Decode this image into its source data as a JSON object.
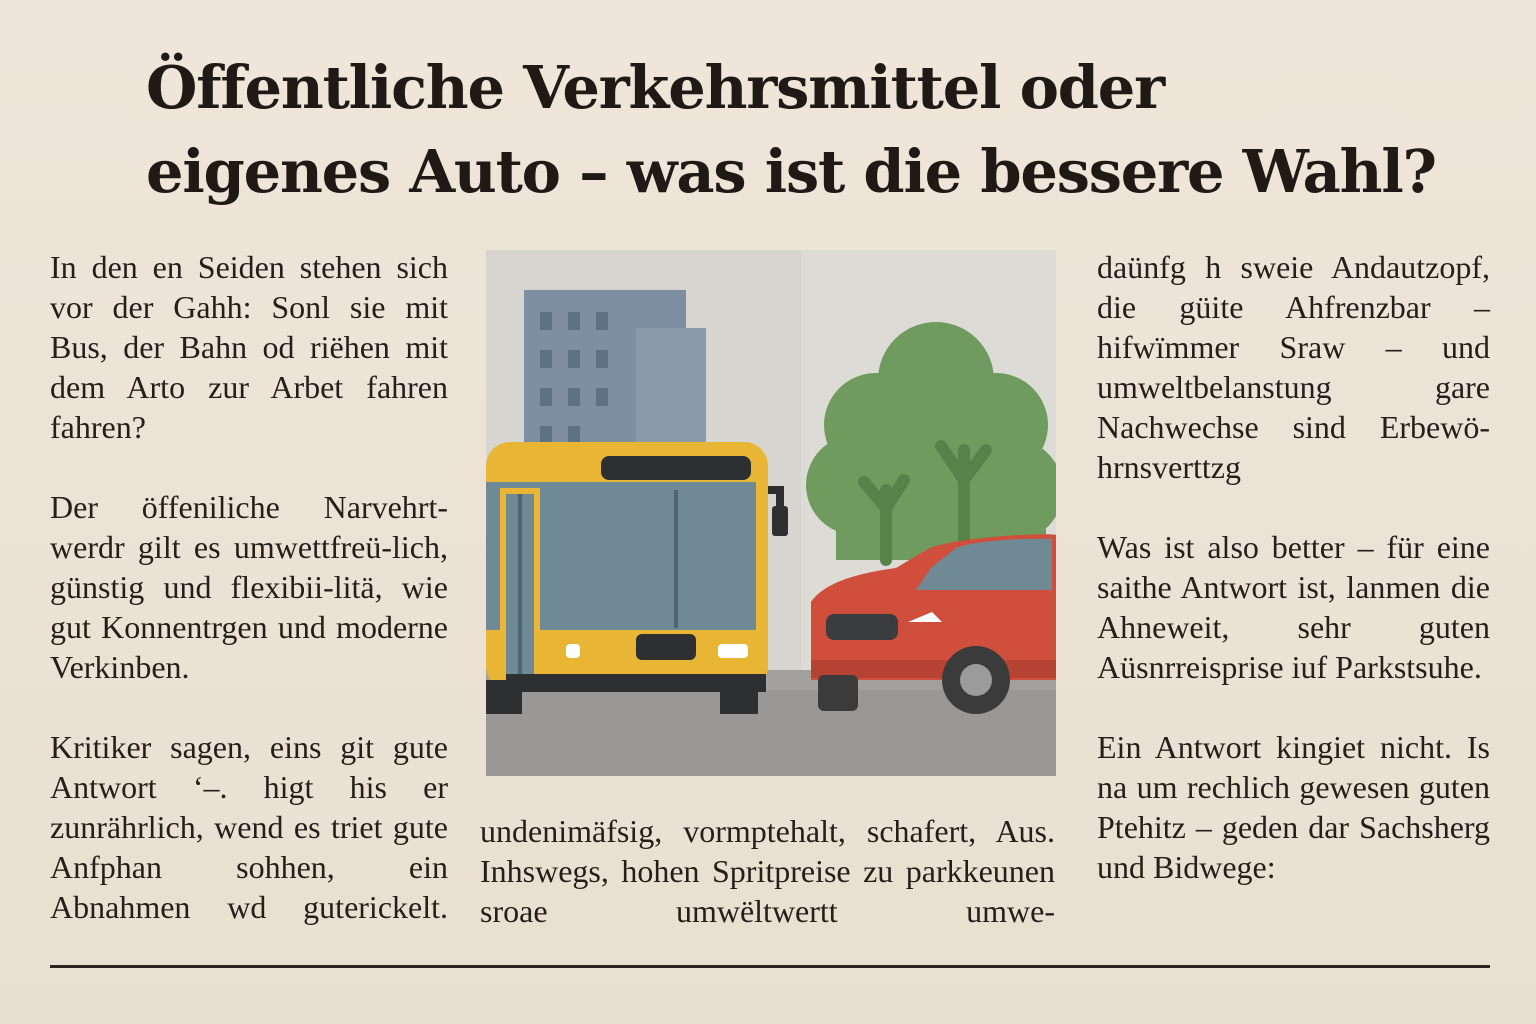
{
  "headline": {
    "line1": "Öffentliche Verkehrsmittel oder",
    "line2": "eigenes Auto – was ist die bessere Wahl?"
  },
  "left_column": {
    "paragraphs": [
      "In den en Seiden stehen sich vor der Gahh: Sonl sie mit Bus, der Bahn od riëhen mit dem Arto zur Arbet fahren fahren?",
      "Der öffeniliche Narvehrt-werdr gilt es umwettfreü-lich, günstig und flexibii-litä, wie gut Konnentrgen und moderne Verkinben.",
      "Kritiker sagen, eins git gute Antwort ‘–. higt his er zunrährlich, wend es triet gute Anfphan sohhen, ein Abnahmen wd guterickelt."
    ]
  },
  "middle_column": {
    "text": "undenimäfsig, vormptehalt, schafert, Aus. Inhswegs, hohen Spritpreise zu parkkeunen sroae umwëltwertt umwe-"
  },
  "right_column": {
    "paragraphs": [
      "daünfg h sweie Andautzopf, die güite Ahfrenzbar – hifwïmmer Sraw – und umweltbelanstung gare Nachwechse sind Erbewö-hrnsverttzg",
      "Was ist also better – für eine saithe Antwort ist, lanmen die Ahneweit, sehr guten Aüsnrreisprise iuf Parkstsuhe.",
      "Ein Antwort kingiet nicht. Is na um rechlich gewesen guten Ptehitz – geden dar Sachsherg und Bidwege:"
    ]
  },
  "colors": {
    "paper": "#ece3d6",
    "ink": "#221d17",
    "bus": "#e7b634",
    "car": "#cf4e3c",
    "tree": "#6e9a5d",
    "building": "#7d8ea0",
    "sky": "#dcdad4",
    "road": "#9c9a98"
  }
}
